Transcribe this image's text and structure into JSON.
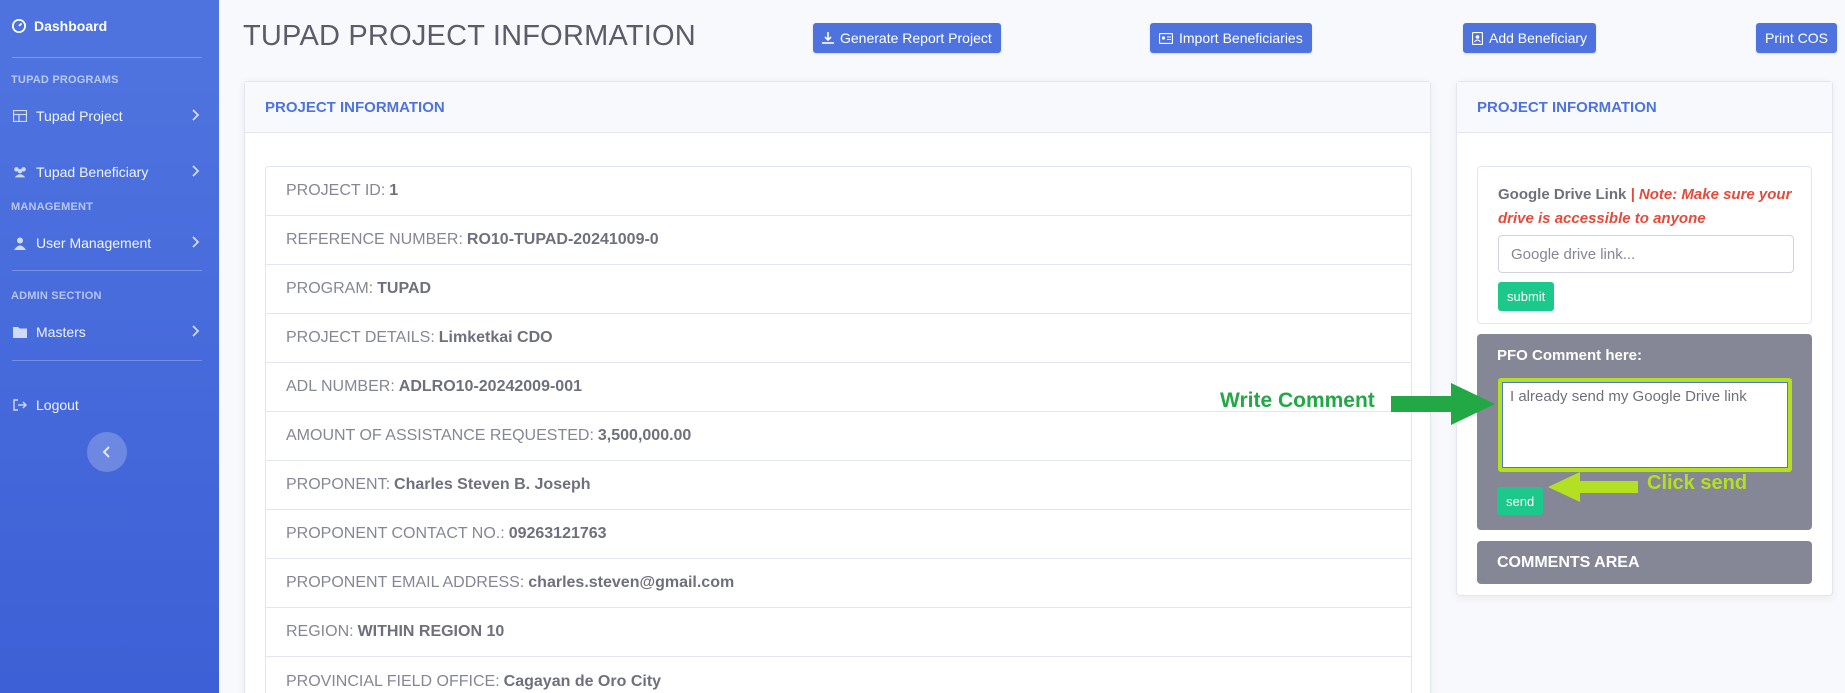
{
  "sidebar": {
    "brand_label": "Dashboard",
    "heading_programs": "TUPAD PROGRAMS",
    "heading_management": "MANAGEMENT",
    "heading_admin": "ADMIN SECTION",
    "items": [
      {
        "label": "Tupad Project",
        "icon": "table-icon"
      },
      {
        "label": "Tupad Beneficiary",
        "icon": "users-icon"
      },
      {
        "label": "User Management",
        "icon": "user-icon"
      },
      {
        "label": "Masters",
        "icon": "folder-icon"
      },
      {
        "label": "Logout",
        "icon": "logout-icon"
      }
    ]
  },
  "header": {
    "title": "TUPAD PROJECT INFORMATION",
    "buttons": {
      "generate_report": "Generate Report Project",
      "import_beneficiaries": "Import Beneficiaries",
      "add_beneficiary": "Add Beneficiary",
      "print_cos": "Print COS"
    }
  },
  "project_card": {
    "title": "PROJECT INFORMATION",
    "rows": [
      {
        "label": "PROJECT ID:",
        "value": "1"
      },
      {
        "label": "REFERENCE NUMBER:",
        "value": "RO10-TUPAD-20241009-0"
      },
      {
        "label": "PROGRAM:",
        "value": "TUPAD"
      },
      {
        "label": "PROJECT DETAILS:",
        "value": "Limketkai CDO"
      },
      {
        "label": "ADL NUMBER:",
        "value": "ADLRO10-20242009-001"
      },
      {
        "label": "AMOUNT OF ASSISTANCE REQUESTED:",
        "value": "3,500,000.00"
      },
      {
        "label": "PROPONENT:",
        "value": "Charles Steven B. Joseph"
      },
      {
        "label": "PROPONENT CONTACT NO.:",
        "value": "09263121763"
      },
      {
        "label": "PROPONENT EMAIL ADDRESS:",
        "value": "charles.steven@gmail.com"
      },
      {
        "label": "REGION:",
        "value": "WITHIN REGION 10"
      },
      {
        "label": "PROVINCIAL FIELD OFFICE:",
        "value": "Cagayan de Oro City"
      }
    ]
  },
  "side_card": {
    "title": "PROJECT INFORMATION",
    "drive_label": "Google Drive Link",
    "drive_note": "| Note: Make sure your drive is accessible to anyone",
    "drive_placeholder": "Google drive link...",
    "submit_label": "submit",
    "pfo_title": "PFO Comment here:",
    "pfo_comment_value": "I already send my Google Drive link",
    "send_label": "send",
    "comments_area_title": "COMMENTS AREA"
  },
  "annotations": {
    "write_comment": "Write Comment",
    "click_send": "Click send",
    "write_color": "#22a845",
    "click_color": "#b3e021"
  },
  "colors": {
    "primary": "#4e73df",
    "success": "#1cc88a",
    "secondary": "#858796",
    "danger": "#e74a3b"
  }
}
